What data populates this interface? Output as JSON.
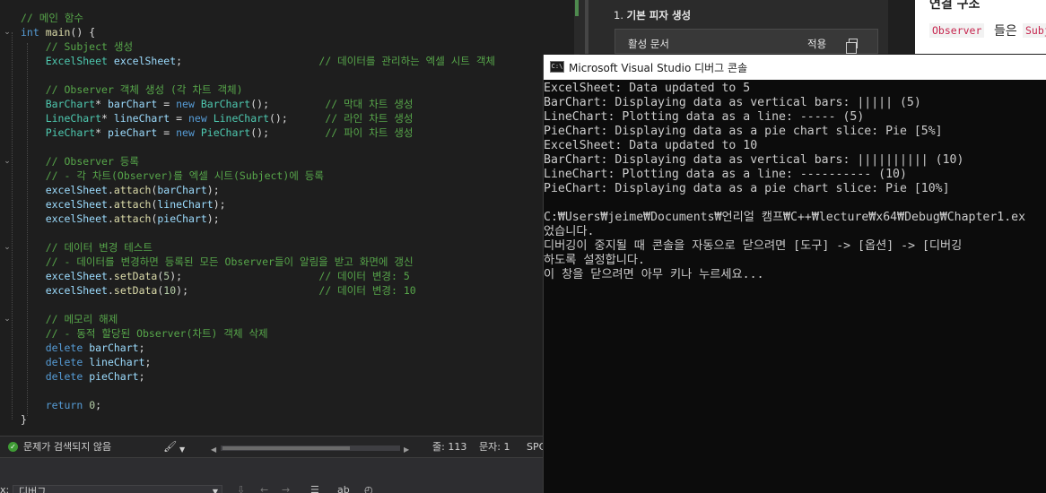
{
  "editor": {
    "lines": [
      [
        [
          "c",
          "// 메인 함수"
        ]
      ],
      [
        [
          "k",
          "int"
        ],
        [
          "p",
          " "
        ],
        [
          "f",
          "main"
        ],
        [
          "p",
          "() {"
        ]
      ],
      [
        [
          "p",
          "    "
        ],
        [
          "c",
          "// Subject 생성"
        ]
      ],
      [
        [
          "p",
          "    "
        ],
        [
          "t",
          "ExcelSheet"
        ],
        [
          "p",
          " "
        ],
        [
          "v",
          "excelSheet"
        ],
        [
          "p",
          ";                      "
        ],
        [
          "c",
          "// 데이터를 관리하는 엑셀 시트 객체"
        ]
      ],
      [],
      [
        [
          "p",
          "    "
        ],
        [
          "c",
          "// Observer 객체 생성 (각 차트 객체)"
        ]
      ],
      [
        [
          "p",
          "    "
        ],
        [
          "t",
          "BarChart"
        ],
        [
          "p",
          "* "
        ],
        [
          "v",
          "barChart"
        ],
        [
          "p",
          " = "
        ],
        [
          "k",
          "new"
        ],
        [
          "p",
          " "
        ],
        [
          "t",
          "BarChart"
        ],
        [
          "p",
          "();         "
        ],
        [
          "c",
          "// 막대 차트 생성"
        ]
      ],
      [
        [
          "p",
          "    "
        ],
        [
          "t",
          "LineChart"
        ],
        [
          "p",
          "* "
        ],
        [
          "v",
          "lineChart"
        ],
        [
          "p",
          " = "
        ],
        [
          "k",
          "new"
        ],
        [
          "p",
          " "
        ],
        [
          "t",
          "LineChart"
        ],
        [
          "p",
          "();      "
        ],
        [
          "c",
          "// 라인 차트 생성"
        ]
      ],
      [
        [
          "p",
          "    "
        ],
        [
          "t",
          "PieChart"
        ],
        [
          "p",
          "* "
        ],
        [
          "v",
          "pieChart"
        ],
        [
          "p",
          " = "
        ],
        [
          "k",
          "new"
        ],
        [
          "p",
          " "
        ],
        [
          "t",
          "PieChart"
        ],
        [
          "p",
          "();         "
        ],
        [
          "c",
          "// 파이 차트 생성"
        ]
      ],
      [],
      [
        [
          "p",
          "    "
        ],
        [
          "c",
          "// Observer 등록"
        ]
      ],
      [
        [
          "p",
          "    "
        ],
        [
          "c",
          "// - 각 차트(Observer)를 엑셀 시트(Subject)에 등록"
        ]
      ],
      [
        [
          "p",
          "    "
        ],
        [
          "v",
          "excelSheet"
        ],
        [
          "p",
          "."
        ],
        [
          "f",
          "attach"
        ],
        [
          "p",
          "("
        ],
        [
          "v",
          "barChart"
        ],
        [
          "p",
          ");"
        ]
      ],
      [
        [
          "p",
          "    "
        ],
        [
          "v",
          "excelSheet"
        ],
        [
          "p",
          "."
        ],
        [
          "f",
          "attach"
        ],
        [
          "p",
          "("
        ],
        [
          "v",
          "lineChart"
        ],
        [
          "p",
          ");"
        ]
      ],
      [
        [
          "p",
          "    "
        ],
        [
          "v",
          "excelSheet"
        ],
        [
          "p",
          "."
        ],
        [
          "f",
          "attach"
        ],
        [
          "p",
          "("
        ],
        [
          "v",
          "pieChart"
        ],
        [
          "p",
          ");"
        ]
      ],
      [],
      [
        [
          "p",
          "    "
        ],
        [
          "c",
          "// 데이터 변경 테스트"
        ]
      ],
      [
        [
          "p",
          "    "
        ],
        [
          "c",
          "// - 데이터를 변경하면 등록된 모든 Observer들이 알림을 받고 화면에 갱신"
        ]
      ],
      [
        [
          "p",
          "    "
        ],
        [
          "v",
          "excelSheet"
        ],
        [
          "p",
          "."
        ],
        [
          "f",
          "setData"
        ],
        [
          "p",
          "("
        ],
        [
          "n",
          "5"
        ],
        [
          "p",
          ");                      "
        ],
        [
          "c",
          "// 데이터 변경: 5"
        ]
      ],
      [
        [
          "p",
          "    "
        ],
        [
          "v",
          "excelSheet"
        ],
        [
          "p",
          "."
        ],
        [
          "f",
          "setData"
        ],
        [
          "p",
          "("
        ],
        [
          "n",
          "10"
        ],
        [
          "p",
          ");                     "
        ],
        [
          "c",
          "// 데이터 변경: 10"
        ]
      ],
      [],
      [
        [
          "p",
          "    "
        ],
        [
          "c",
          "// 메모리 해제"
        ]
      ],
      [
        [
          "p",
          "    "
        ],
        [
          "c",
          "// - 동적 할당된 Observer(차트) 객체 삭제"
        ]
      ],
      [
        [
          "p",
          "    "
        ],
        [
          "k",
          "delete"
        ],
        [
          "p",
          " "
        ],
        [
          "v",
          "barChart"
        ],
        [
          "p",
          ";"
        ]
      ],
      [
        [
          "p",
          "    "
        ],
        [
          "k",
          "delete"
        ],
        [
          "p",
          " "
        ],
        [
          "v",
          "lineChart"
        ],
        [
          "p",
          ";"
        ]
      ],
      [
        [
          "p",
          "    "
        ],
        [
          "k",
          "delete"
        ],
        [
          "p",
          " "
        ],
        [
          "v",
          "pieChart"
        ],
        [
          "p",
          ";"
        ]
      ],
      [],
      [
        [
          "p",
          "    "
        ],
        [
          "k",
          "return"
        ],
        [
          "p",
          " "
        ],
        [
          "n",
          "0"
        ],
        [
          "p",
          ";"
        ]
      ],
      [
        [
          "p",
          "}"
        ]
      ]
    ],
    "fold_markers": "⌄"
  },
  "statusbar": {
    "status_text": "문제가 검색되지 않음",
    "ok_icon": "check-icon",
    "line_label": "줄: 113",
    "col_label": "문자: 1",
    "spc_label": "SPC"
  },
  "bottom_panel": {
    "prefix": "x:",
    "dropdown_value": "디버그"
  },
  "docs": {
    "step_number": "1.",
    "step_title": "기본 피자 생성",
    "row_label": "활성 문서",
    "row_apply": "적용"
  },
  "blog": {
    "heading": "연결 구조",
    "code1": "Observer",
    "text": "들은",
    "code2": "Subj"
  },
  "console": {
    "title": "Microsoft Visual Studio 디버그 콘솔",
    "icon_text": "C:\\",
    "lines": [
      "ExcelSheet: Data updated to 5",
      "BarChart: Displaying data as vertical bars: ||||| (5)",
      "LineChart: Plotting data as a line: ----- (5)",
      "PieChart: Displaying data as a pie chart slice: Pie [5%]",
      "ExcelSheet: Data updated to 10",
      "BarChart: Displaying data as vertical bars: |||||||||| (10)",
      "LineChart: Plotting data as a line: ---------- (10)",
      "PieChart: Displaying data as a pie chart slice: Pie [10%]",
      "",
      "C:₩Users₩jeime₩Documents₩언리얼 캠프₩C++₩lecture₩x64₩Debug₩Chapter1.ex",
      "었습니다.",
      "디버깅이 중지될 때 콘솔을 자동으로 닫으려면 [도구] -> [옵션] -> [디버깅",
      "하도록 설정합니다.",
      "이 창을 닫으려면 아무 키나 누르세요..."
    ]
  }
}
